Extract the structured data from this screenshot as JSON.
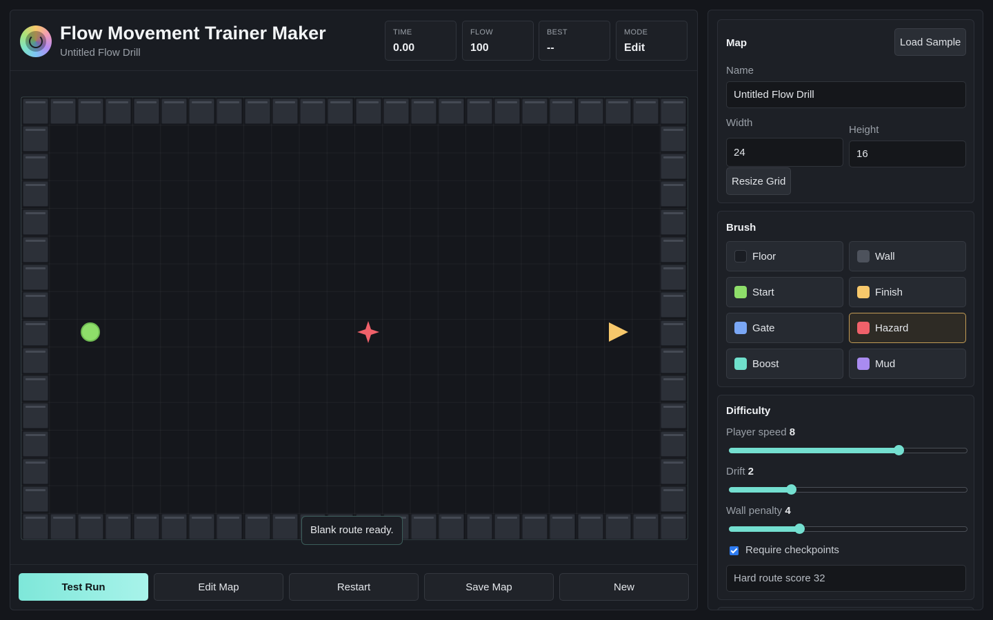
{
  "header": {
    "title": "Flow Movement Trainer Maker",
    "subtitle": "Untitled Flow Drill",
    "stats": [
      {
        "label": "TIME",
        "value": "0.00"
      },
      {
        "label": "FLOW",
        "value": "100"
      },
      {
        "label": "BEST",
        "value": "--"
      },
      {
        "label": "MODE",
        "value": "Edit"
      }
    ]
  },
  "board": {
    "columns": 24,
    "rows": 16,
    "toast": "Blank route ready.",
    "colors": {
      "wall": "#2c3038",
      "start": "#8ede6a",
      "hazard": "#f0616a",
      "finish": "#f7c86b"
    }
  },
  "footer": {
    "buttons": [
      "Test Run",
      "Edit Map",
      "Restart",
      "Save Map",
      "New"
    ]
  },
  "map": {
    "title": "Map",
    "load_sample": "Load Sample",
    "name_label": "Name",
    "name_value": "Untitled Flow Drill",
    "width_label": "Width",
    "width_value": "24",
    "height_label": "Height",
    "height_value": "16",
    "resize": "Resize Grid"
  },
  "brush": {
    "title": "Brush",
    "selected": "Hazard",
    "items": [
      {
        "label": "Floor",
        "color": "#1a1d23"
      },
      {
        "label": "Wall",
        "color": "#4d525c"
      },
      {
        "label": "Start",
        "color": "#8ede6a"
      },
      {
        "label": "Finish",
        "color": "#f7c86b"
      },
      {
        "label": "Gate",
        "color": "#7aa7f5"
      },
      {
        "label": "Hazard",
        "color": "#f0616a"
      },
      {
        "label": "Boost",
        "color": "#6fe0cc"
      },
      {
        "label": "Mud",
        "color": "#a98bf0"
      }
    ]
  },
  "difficulty": {
    "title": "Difficulty",
    "accent": "#74dfd0",
    "sliders": [
      {
        "label": "Player speed",
        "value": "8",
        "fraction": 0.71
      },
      {
        "label": "Drift",
        "value": "2",
        "fraction": 0.26
      },
      {
        "label": "Wall penalty",
        "value": "4",
        "fraction": 0.295
      }
    ],
    "checkbox_label": "Require checkpoints",
    "checkbox_checked": true,
    "score_text": "Hard route score 32"
  }
}
